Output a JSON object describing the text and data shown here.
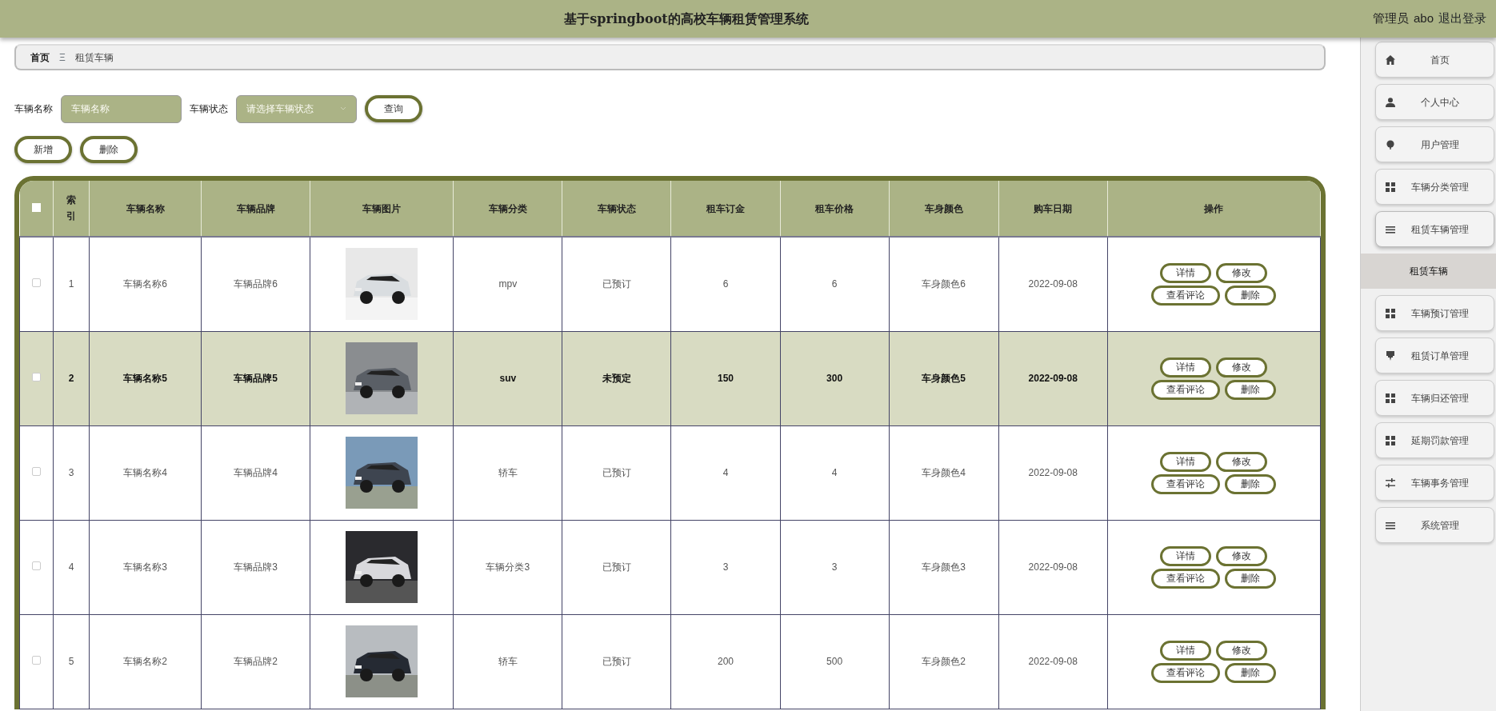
{
  "header": {
    "title": "基于springboot的高校车辆租赁管理系统",
    "role": "管理员",
    "username": "abo",
    "logout": "退出登录"
  },
  "breadcrumb": {
    "items": [
      "首页",
      "租赁车辆"
    ],
    "separator": "Ξ"
  },
  "search": {
    "fields": [
      {
        "label": "车辆名称",
        "placeholder": "车辆名称",
        "kind": "input"
      },
      {
        "label": "车辆状态",
        "placeholder": "请选择车辆状态",
        "kind": "select"
      }
    ],
    "button": "查询"
  },
  "actions": [
    "新增",
    "删除"
  ],
  "table": {
    "select_all_checked": false,
    "columns": [
      "索引",
      "车辆名称",
      "车辆品牌",
      "车辆图片",
      "车辆分类",
      "车辆状态",
      "租车订金",
      "租车价格",
      "车身颜色",
      "购车日期",
      "操作"
    ],
    "rows": [
      {
        "checked": false,
        "highlighted": false,
        "index": "1",
        "name": "车辆名称6",
        "brand": "车辆品牌6",
        "picture": {
          "kind": "picture"
        },
        "category": "mpv",
        "status": "已预订",
        "deposit": "6",
        "price": "6",
        "body_color": "车身颜色6",
        "date": "2022-09-08",
        "actions": [
          "详情",
          "修改",
          "查看评论",
          "删除"
        ]
      },
      {
        "checked": false,
        "highlighted": true,
        "index": "2",
        "name": "车辆名称5",
        "brand": "车辆品牌5",
        "picture": {
          "kind": "picture"
        },
        "category": "suv",
        "status": "未预定",
        "deposit": "150",
        "price": "300",
        "body_color": "车身颜色5",
        "date": "2022-09-08",
        "actions": [
          "详情",
          "修改",
          "查看评论",
          "删除"
        ]
      },
      {
        "checked": false,
        "highlighted": false,
        "index": "3",
        "name": "车辆名称4",
        "brand": "车辆品牌4",
        "picture": {
          "kind": "picture"
        },
        "category": "轿车",
        "status": "已预订",
        "deposit": "4",
        "price": "4",
        "body_color": "车身颜色4",
        "date": "2022-09-08",
        "actions": [
          "详情",
          "修改",
          "查看评论",
          "删除"
        ]
      },
      {
        "checked": false,
        "highlighted": false,
        "index": "4",
        "name": "车辆名称3",
        "brand": "车辆品牌3",
        "picture": {
          "kind": "picture"
        },
        "category": "车辆分类3",
        "status": "已预订",
        "deposit": "3",
        "price": "3",
        "body_color": "车身颜色3",
        "date": "2022-09-08",
        "actions": [
          "详情",
          "修改",
          "查看评论",
          "删除"
        ]
      },
      {
        "checked": false,
        "highlighted": false,
        "index": "5",
        "name": "车辆名称2",
        "brand": "车辆品牌2",
        "picture": {
          "kind": "picture"
        },
        "category": "轿车",
        "status": "已预订",
        "deposit": "200",
        "price": "500",
        "body_color": "车身颜色2",
        "date": "2022-09-08",
        "actions": [
          "详情",
          "修改",
          "查看评论",
          "删除"
        ]
      }
    ]
  },
  "sidebar": {
    "items": [
      {
        "label": "首页",
        "selected": false
      },
      {
        "label": "个人中心",
        "selected": false
      },
      {
        "label": "用户管理",
        "selected": false
      },
      {
        "label": "车辆分类管理",
        "selected": false
      },
      {
        "label": "租赁车辆管理",
        "selected": false,
        "expanded": true,
        "children": [
          {
            "label": "租赁车辆",
            "selected": true
          }
        ]
      },
      {
        "label": "车辆预订管理",
        "selected": false
      },
      {
        "label": "租赁订单管理",
        "selected": false
      },
      {
        "label": "车辆归还管理",
        "selected": false
      },
      {
        "label": "延期罚款管理",
        "selected": false
      },
      {
        "label": "车辆事务管理",
        "selected": false
      },
      {
        "label": "系统管理",
        "selected": false
      }
    ]
  }
}
